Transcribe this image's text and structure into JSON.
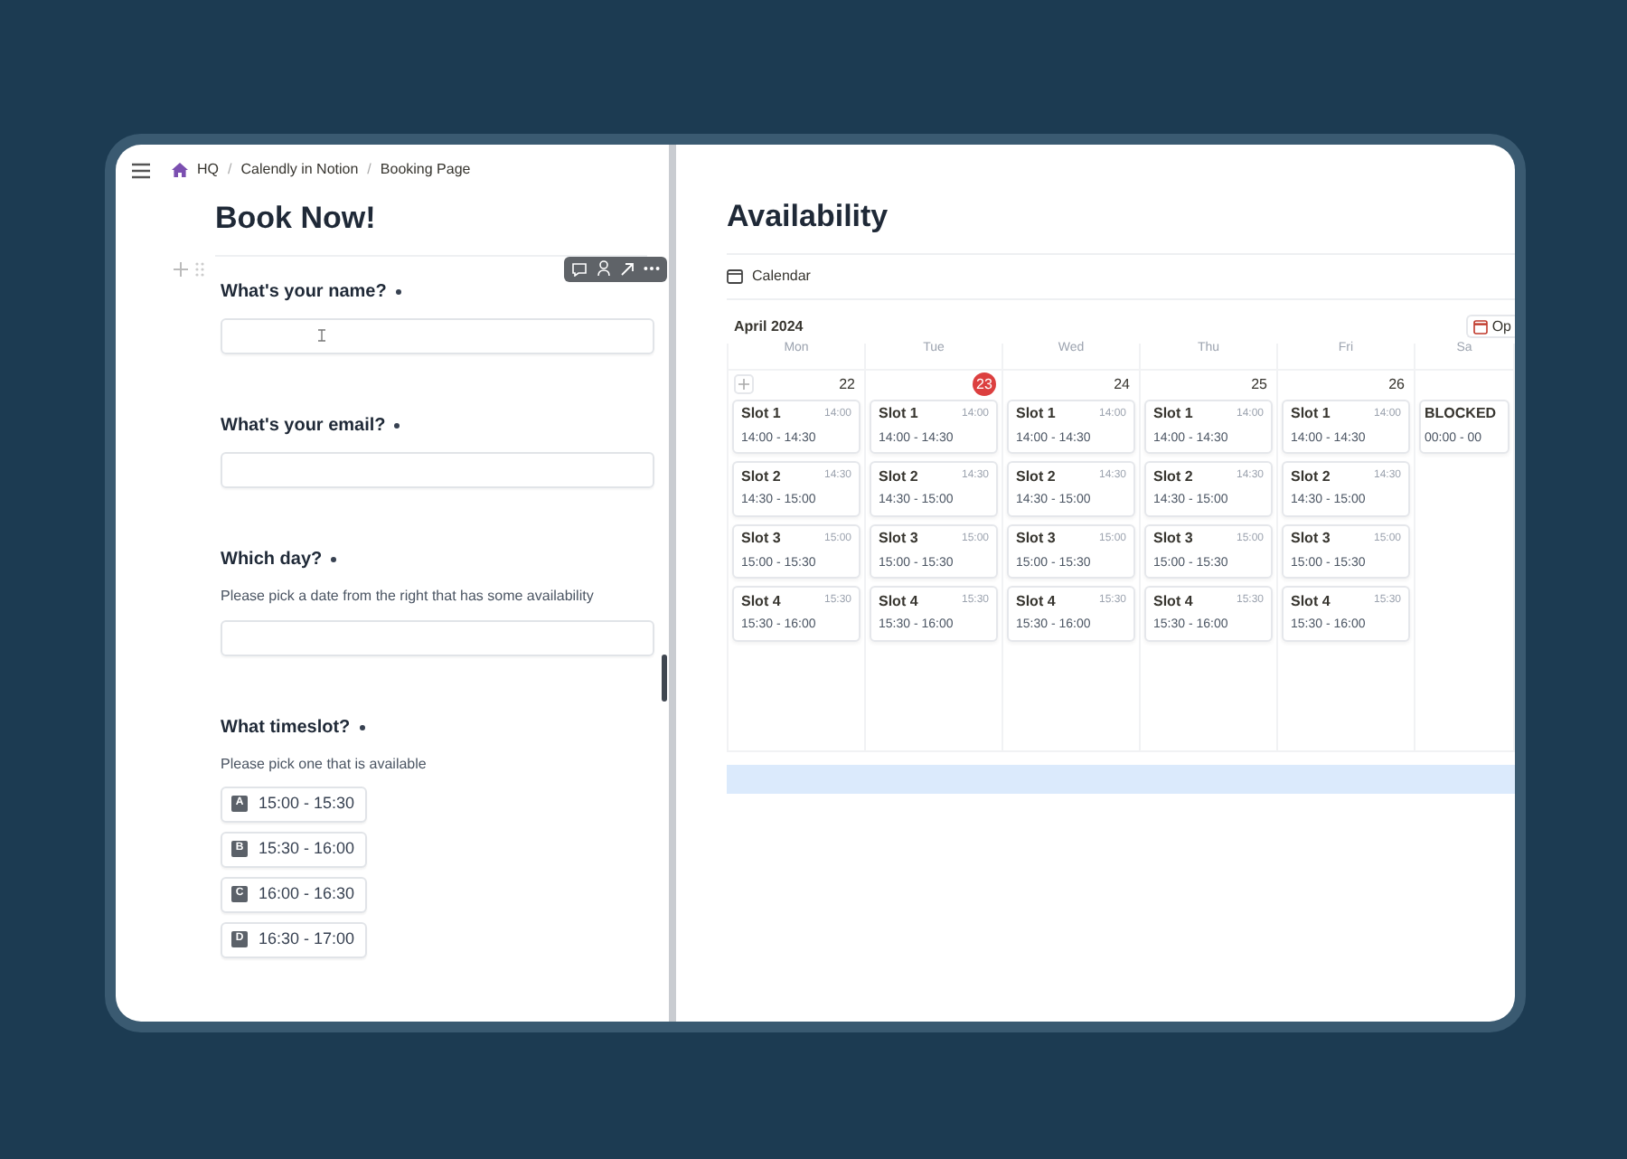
{
  "breadcrumb": [
    {
      "label": "HQ"
    },
    {
      "separator": "/",
      "label": "Calendly in Notion"
    },
    {
      "separator": "/",
      "label": "Booking Page"
    }
  ],
  "form": {
    "title": "Book Now!",
    "questions": [
      {
        "kind": "text",
        "label": "What's your name?",
        "required": true,
        "cursor": true
      },
      {
        "kind": "text",
        "label": "What's your email?",
        "required": true
      },
      {
        "kind": "text",
        "label": "Which day?",
        "required": true,
        "description": "Please pick a date from the right that has some availability"
      },
      {
        "kind": "choice",
        "label": "What timeslot?",
        "required": true,
        "description": "Please pick one that is available",
        "options": [
          {
            "letter": "A",
            "label": "15:00 - 15:30"
          },
          {
            "letter": "B",
            "label": "15:30 - 16:00"
          },
          {
            "letter": "C",
            "label": "16:00 - 16:30"
          },
          {
            "letter": "D",
            "label": "16:30 - 17:00"
          }
        ]
      }
    ]
  },
  "calendar": {
    "title": "Availability",
    "view": "Calendar",
    "month": "April 2024",
    "open_button": "Op",
    "days": [
      {
        "name": "Mon",
        "date": "22",
        "today": false,
        "events": [
          {
            "title": "Slot 1",
            "time": "14:00",
            "range": "14:00 - 14:30"
          },
          {
            "title": "Slot 2",
            "time": "14:30",
            "range": "14:30 - 15:00"
          },
          {
            "title": "Slot 3",
            "time": "15:00",
            "range": "15:00 - 15:30"
          },
          {
            "title": "Slot 4",
            "time": "15:30",
            "range": "15:30 - 16:00"
          }
        ]
      },
      {
        "name": "Tue",
        "date": "23",
        "today": true,
        "events": [
          {
            "title": "Slot 1",
            "time": "14:00",
            "range": "14:00 - 14:30"
          },
          {
            "title": "Slot 2",
            "time": "14:30",
            "range": "14:30 - 15:00"
          },
          {
            "title": "Slot 3",
            "time": "15:00",
            "range": "15:00 - 15:30"
          },
          {
            "title": "Slot 4",
            "time": "15:30",
            "range": "15:30 - 16:00"
          }
        ]
      },
      {
        "name": "Wed",
        "date": "24",
        "today": false,
        "events": [
          {
            "title": "Slot 1",
            "time": "14:00",
            "range": "14:00 - 14:30"
          },
          {
            "title": "Slot 2",
            "time": "14:30",
            "range": "14:30 - 15:00"
          },
          {
            "title": "Slot 3",
            "time": "15:00",
            "range": "15:00 - 15:30"
          },
          {
            "title": "Slot 4",
            "time": "15:30",
            "range": "15:30 - 16:00"
          }
        ]
      },
      {
        "name": "Thu",
        "date": "25",
        "today": false,
        "events": [
          {
            "title": "Slot 1",
            "time": "14:00",
            "range": "14:00 - 14:30"
          },
          {
            "title": "Slot 2",
            "time": "14:30",
            "range": "14:30 - 15:00"
          },
          {
            "title": "Slot 3",
            "time": "15:00",
            "range": "15:00 - 15:30"
          },
          {
            "title": "Slot 4",
            "time": "15:30",
            "range": "15:30 - 16:00"
          }
        ]
      },
      {
        "name": "Fri",
        "date": "26",
        "today": false,
        "events": [
          {
            "title": "Slot 1",
            "time": "14:00",
            "range": "14:00 - 14:30"
          },
          {
            "title": "Slot 2",
            "time": "14:30",
            "range": "14:30 - 15:00"
          },
          {
            "title": "Slot 3",
            "time": "15:00",
            "range": "15:00 - 15:30"
          },
          {
            "title": "Slot 4",
            "time": "15:30",
            "range": "15:30 - 16:00"
          }
        ]
      },
      {
        "name": "Sa",
        "events": [
          {
            "title": "BLOCKED",
            "range": "00:00 - 00"
          }
        ]
      }
    ]
  }
}
